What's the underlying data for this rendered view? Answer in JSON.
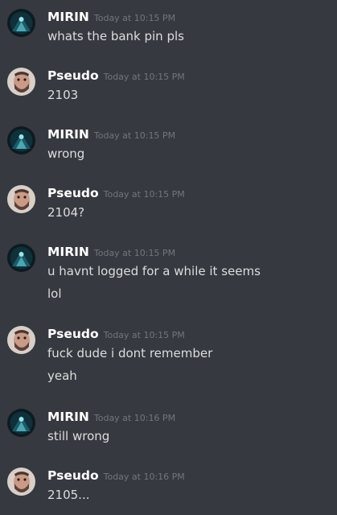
{
  "messages": [
    {
      "user": "MIRIN",
      "avatar_icon": "dark-teal-character-avatar-icon",
      "timestamp": "Today at 10:15 PM",
      "lines": [
        "whats the bank pin pls"
      ]
    },
    {
      "user": "Pseudo",
      "avatar_icon": "bearded-man-avatar-icon",
      "timestamp": "Today at 10:15 PM",
      "lines": [
        "2103"
      ]
    },
    {
      "user": "MIRIN",
      "avatar_icon": "dark-teal-character-avatar-icon",
      "timestamp": "Today at 10:15 PM",
      "lines": [
        "wrong"
      ]
    },
    {
      "user": "Pseudo",
      "avatar_icon": "bearded-man-avatar-icon",
      "timestamp": "Today at 10:15 PM",
      "lines": [
        "2104?"
      ]
    },
    {
      "user": "MIRIN",
      "avatar_icon": "dark-teal-character-avatar-icon",
      "timestamp": "Today at 10:15 PM",
      "lines": [
        "u havnt logged for a while it seems",
        "lol"
      ]
    },
    {
      "user": "Pseudo",
      "avatar_icon": "bearded-man-avatar-icon",
      "timestamp": "Today at 10:15 PM",
      "lines": [
        "fuck dude i dont remember",
        "yeah"
      ]
    },
    {
      "user": "MIRIN",
      "avatar_icon": "dark-teal-character-avatar-icon",
      "timestamp": "Today at 10:16 PM",
      "lines": [
        "still wrong"
      ]
    },
    {
      "user": "Pseudo",
      "avatar_icon": "bearded-man-avatar-icon",
      "timestamp": "Today at 10:16 PM",
      "lines": [
        "2105..."
      ]
    }
  ],
  "colors": {
    "background": "#36393f",
    "username": "#ffffff",
    "timestamp": "#72767d",
    "message_text": "#dcddde"
  }
}
